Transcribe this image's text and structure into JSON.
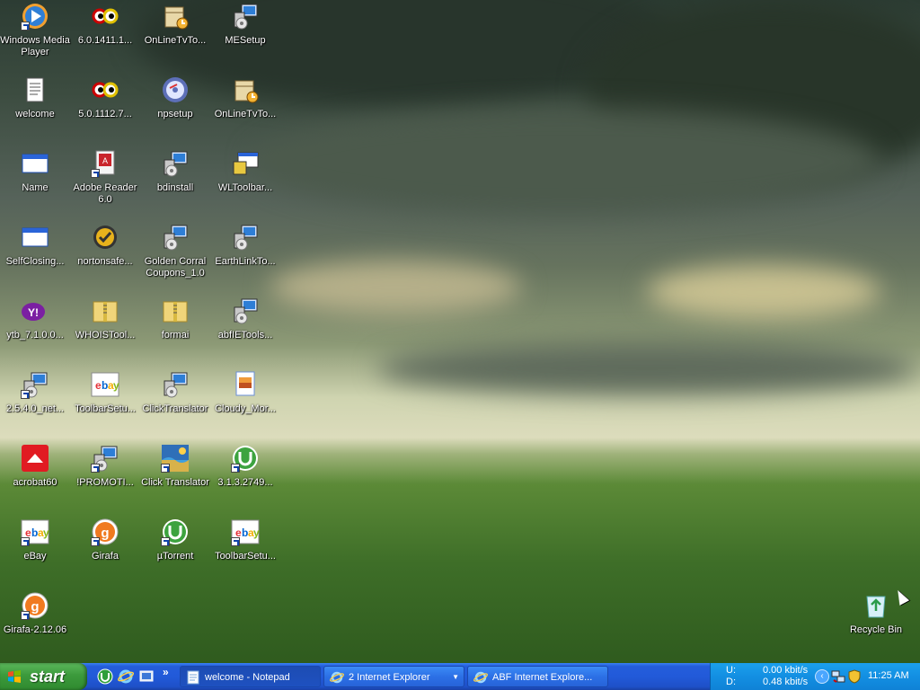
{
  "desktop": {
    "icons": [
      {
        "label": "Windows Media Player",
        "icon": "media-player-icon"
      },
      {
        "label": "6.0.1411.1...",
        "icon": "eyes-icon"
      },
      {
        "label": "OnLineTvTo...",
        "icon": "installer-box-icon"
      },
      {
        "label": "MESetup",
        "icon": "setup-computer-icon"
      },
      {
        "label": "welcome",
        "icon": "text-file-icon"
      },
      {
        "label": "5.0.1112.7...",
        "icon": "eyes-icon"
      },
      {
        "label": "npsetup",
        "icon": "cd-setup-icon"
      },
      {
        "label": "OnLineTvTo...",
        "icon": "installer-box-icon"
      },
      {
        "label": "Name",
        "icon": "window-icon"
      },
      {
        "label": "Adobe Reader 6.0",
        "icon": "adobe-reader-icon"
      },
      {
        "label": "bdinstall",
        "icon": "setup-computer-icon"
      },
      {
        "label": "WLToolbar...",
        "icon": "toolbar-setup-icon"
      },
      {
        "label": "SelfClosing...",
        "icon": "window-icon"
      },
      {
        "label": "nortonsafe...",
        "icon": "norton-icon"
      },
      {
        "label": "Golden Corral Coupons_1.0",
        "icon": "setup-computer-icon"
      },
      {
        "label": "EarthLinkTo...",
        "icon": "setup-computer-icon"
      },
      {
        "label": "ytb_7.1.0.0...",
        "icon": "yahoo-icon"
      },
      {
        "label": "WHOISTool...",
        "icon": "zip-folder-icon"
      },
      {
        "label": "formai",
        "icon": "zip-folder-icon"
      },
      {
        "label": "abfIETools...",
        "icon": "setup-computer-icon"
      },
      {
        "label": "2.5.4.0_net...",
        "icon": "setup-computer-icon"
      },
      {
        "label": "ToolbarSetu...",
        "icon": "ebay-icon"
      },
      {
        "label": "ClickTranslator",
        "icon": "setup-computer-icon"
      },
      {
        "label": "Cloudy_Mor...",
        "icon": "image-file-icon"
      },
      {
        "label": "acrobat60",
        "icon": "acrobat-icon"
      },
      {
        "label": "!PROMOTI...",
        "icon": "setup-computer-icon"
      },
      {
        "label": "Click Translator",
        "icon": "click-translator-icon"
      },
      {
        "label": "3.1.3.2749...",
        "icon": "utorrent-icon"
      },
      {
        "label": "eBay",
        "icon": "ebay-icon"
      },
      {
        "label": "Girafa",
        "icon": "girafa-icon"
      },
      {
        "label": "µTorrent",
        "icon": "utorrent-icon"
      },
      {
        "label": "ToolbarSetu...",
        "icon": "ebay-icon"
      },
      {
        "label": "Girafa-2.12.06",
        "icon": "girafa-icon"
      },
      {
        "label": "Recycle Bin",
        "icon": "recycle-bin-icon"
      }
    ]
  },
  "taskbar": {
    "start_label": "start",
    "tasks": [
      {
        "label": "welcome - Notepad",
        "icon": "notepad-icon"
      },
      {
        "label": "2 Internet Explorer",
        "icon": "internet-explorer-icon"
      },
      {
        "label": "ABF Internet Explore...",
        "icon": "internet-explorer-icon"
      }
    ],
    "tray": {
      "upload_label": "U:",
      "download_label": "D:",
      "upload_rate": "0.00 kbit/s",
      "download_rate": "0.48 kbit/s",
      "clock": "11:25 AM"
    }
  },
  "colors": {
    "taskbar_blue": "#245ddb",
    "start_green": "#3c9a3c",
    "tray_blue": "#138fe2"
  }
}
